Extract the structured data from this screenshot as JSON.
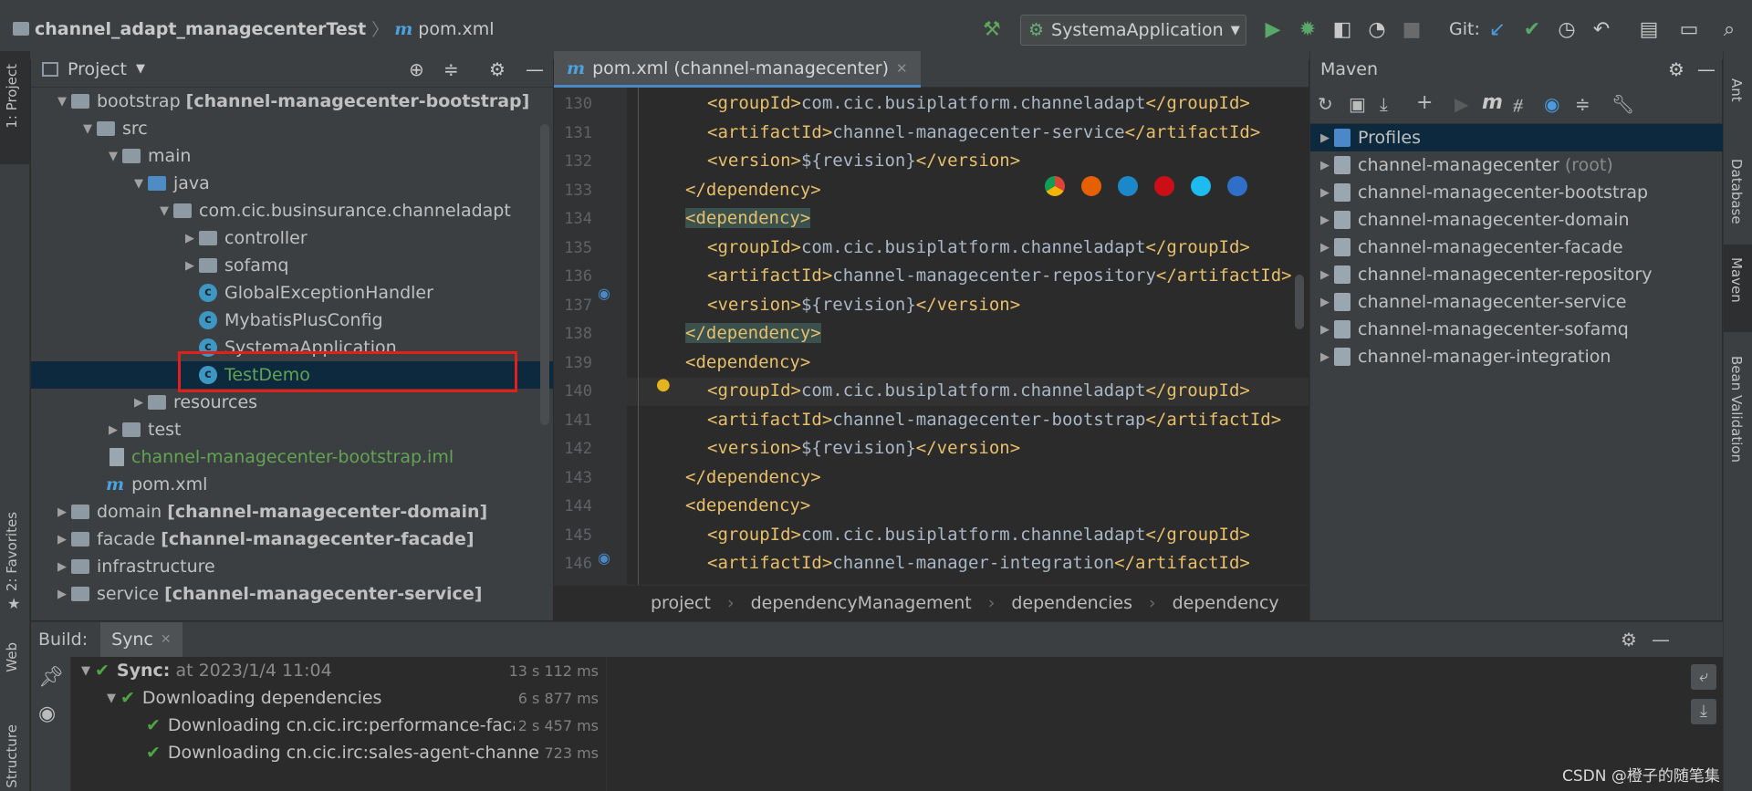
{
  "titlebar": {
    "project_name": "channel_adapt_managecenterTest",
    "file_name": "pom.xml",
    "run_config": "SystemaApplication",
    "git_label": "Git:"
  },
  "left_stripe": {
    "project": "1: Project",
    "favorites": "2: Favorites",
    "web": "Web",
    "structure": "Structure"
  },
  "right_stripe": {
    "ant": "Ant",
    "database": "Database",
    "maven": "Maven",
    "bean_validation": "Bean Validation"
  },
  "project_panel": {
    "title": "Project",
    "tree": [
      {
        "name": "bootstrap",
        "module": "[channel-managecenter-bootstrap]"
      },
      {
        "name": "src"
      },
      {
        "name": "main"
      },
      {
        "name": "java"
      },
      {
        "name": "com.cic.businsurance.channeladapt"
      },
      {
        "name": "controller"
      },
      {
        "name": "sofamq"
      },
      {
        "name": "GlobalExceptionHandler"
      },
      {
        "name": "MybatisPlusConfig"
      },
      {
        "name": "SystemaApplication"
      },
      {
        "name": "TestDemo"
      },
      {
        "name": "resources"
      },
      {
        "name": "test"
      },
      {
        "name": "channel-managecenter-bootstrap.iml"
      },
      {
        "name": "pom.xml"
      },
      {
        "name": "domain",
        "module": "[channel-managecenter-domain]"
      },
      {
        "name": "facade",
        "module": "[channel-managecenter-facade]"
      },
      {
        "name": "infrastructure"
      },
      {
        "name": "service",
        "module": "[channel-managecenter-service]"
      }
    ]
  },
  "editor": {
    "tab_label": "pom.xml (channel-managecenter)",
    "lines": [
      {
        "num": "130",
        "tag_open": "<groupId>",
        "text": "com.cic.busiplatform.channeladapt",
        "tag_close": "</groupId>"
      },
      {
        "num": "131",
        "tag_open": "<artifactId>",
        "text": "channel-managecenter-service",
        "tag_close": "</artifactId>"
      },
      {
        "num": "132",
        "tag_open": "<version>",
        "text": "${revision}",
        "tag_close": "</version>"
      },
      {
        "num": "133",
        "tag_open": "</dependency>",
        "text": "",
        "tag_close": ""
      },
      {
        "num": "134",
        "tag_open": "<dependency>",
        "text": "",
        "tag_close": ""
      },
      {
        "num": "135",
        "tag_open": "<groupId>",
        "text": "com.cic.busiplatform.channeladapt",
        "tag_close": "</groupId>"
      },
      {
        "num": "136",
        "tag_open": "<artifactId>",
        "text": "channel-managecenter-repository",
        "tag_close": "</artifactId>"
      },
      {
        "num": "137",
        "tag_open": "<version>",
        "text": "${revision}",
        "tag_close": "</version>"
      },
      {
        "num": "138",
        "tag_open": "</dependency>",
        "text": "",
        "tag_close": ""
      },
      {
        "num": "139",
        "tag_open": "<dependency>",
        "text": "",
        "tag_close": ""
      },
      {
        "num": "140",
        "tag_open": "<groupId>",
        "text": "com.cic.busiplatform.channeladapt",
        "tag_close": "</groupId>"
      },
      {
        "num": "141",
        "tag_open": "<artifactId>",
        "text": "channel-managecenter-bootstrap",
        "tag_close": "</artifactId>"
      },
      {
        "num": "142",
        "tag_open": "<version>",
        "text": "${revision}",
        "tag_close": "</version>"
      },
      {
        "num": "143",
        "tag_open": "</dependency>",
        "text": "",
        "tag_close": ""
      },
      {
        "num": "144",
        "tag_open": "<dependency>",
        "text": "",
        "tag_close": ""
      },
      {
        "num": "145",
        "tag_open": "<groupId>",
        "text": "com.cic.busiplatform.channeladapt",
        "tag_close": "</groupId>"
      },
      {
        "num": "146",
        "tag_open": "<artifactId>",
        "text": "channel-manager-integration",
        "tag_close": "</artifactId>"
      }
    ],
    "breadcrumb": [
      "project",
      "dependencyManagement",
      "dependencies",
      "dependency"
    ]
  },
  "maven": {
    "title": "Maven",
    "items": [
      {
        "name": "Profiles",
        "suffix": ""
      },
      {
        "name": "channel-managecenter",
        "suffix": "(root)"
      },
      {
        "name": "channel-managecenter-bootstrap",
        "suffix": ""
      },
      {
        "name": "channel-managecenter-domain",
        "suffix": ""
      },
      {
        "name": "channel-managecenter-facade",
        "suffix": ""
      },
      {
        "name": "channel-managecenter-repository",
        "suffix": ""
      },
      {
        "name": "channel-managecenter-service",
        "suffix": ""
      },
      {
        "name": "channel-managecenter-sofamq",
        "suffix": ""
      },
      {
        "name": "channel-manager-integration",
        "suffix": ""
      }
    ]
  },
  "build": {
    "label": "Build:",
    "tab": "Sync",
    "rows": [
      {
        "title": "Sync:",
        "detail": "at 2023/1/4 11:04",
        "time": "13 s 112 ms"
      },
      {
        "title": "Downloading dependencies",
        "detail": "",
        "time": "6 s 877 ms"
      },
      {
        "title": "Downloading cn.cic.irc:performance-facade::",
        "detail": "",
        "time": "2 s 457 ms"
      },
      {
        "title": "Downloading cn.cic.irc:sales-agent-channel-faca",
        "detail": "",
        "time": "723 ms"
      }
    ]
  },
  "watermark": "CSDN @橙子的随笔集",
  "colors": {
    "accent": "#4a88c7",
    "selection": "#0d293e",
    "highlight_box": "#e0201b",
    "xml_tag": "#e8bf6a",
    "text": "#a9b7c6"
  }
}
